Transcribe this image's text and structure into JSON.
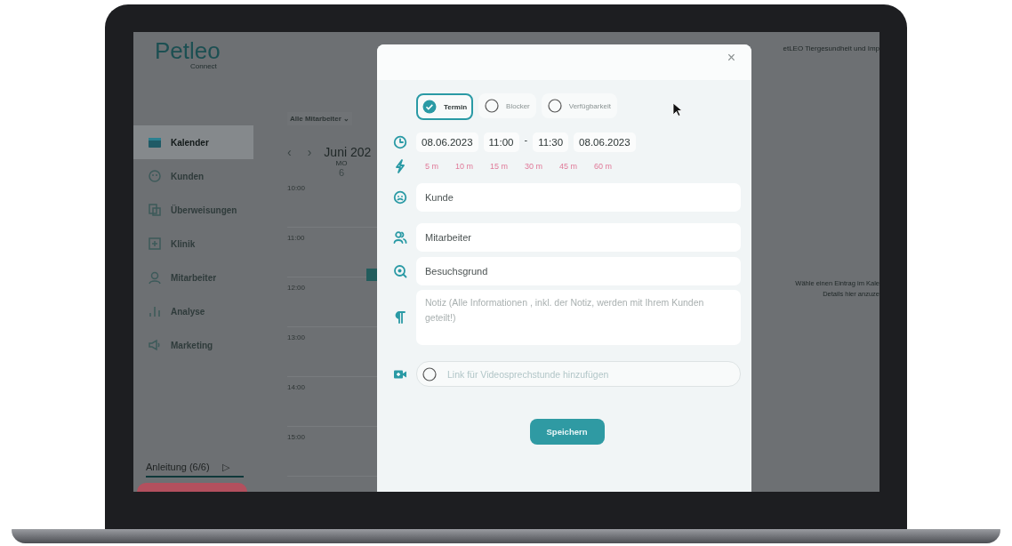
{
  "header": {
    "logo": "Petleo",
    "logo_sub": "Connect",
    "account": "etLEO Tiergesundheit und Imp"
  },
  "sidebar": {
    "items": [
      {
        "label": "Kalender",
        "selected": true
      },
      {
        "label": "Kunden",
        "selected": false
      },
      {
        "label": "Überweisungen",
        "selected": false
      },
      {
        "label": "Klinik",
        "selected": false
      },
      {
        "label": "Mitarbeiter",
        "selected": false
      },
      {
        "label": "Analyse",
        "selected": false
      },
      {
        "label": "Marketing",
        "selected": false
      }
    ],
    "guide": "Anleitung (6/6)",
    "guide_arrow": "▷"
  },
  "calendar": {
    "staff_filter": "Alle Mitarbeiter",
    "filter_caret": "⌄",
    "previous": "‹",
    "next": "›",
    "month": "Juni 202",
    "day_name": "MO",
    "day_number": "6",
    "times": [
      "10:00",
      "11:00",
      "12:00",
      "13:00",
      "14:00",
      "15:00"
    ]
  },
  "detail_hint": [
    "Wähle einen Eintrag im Kale",
    "Details hier anzuze"
  ],
  "modal": {
    "close": "×",
    "types": [
      {
        "label": "Termin",
        "selected": true
      },
      {
        "label": "Blocker",
        "selected": false
      },
      {
        "label": "Verfügbarkeit",
        "selected": false
      }
    ],
    "start_date": "08.06.2023",
    "start_time": "11:00",
    "separator": "-",
    "end_time": "11:30",
    "end_date": "08.06.2023",
    "durations": [
      "5 m",
      "10 m",
      "15 m",
      "30 m",
      "45 m",
      "60 m"
    ],
    "fields": [
      {
        "placeholder": "Kunde"
      },
      {
        "placeholder": "Mitarbeiter"
      },
      {
        "placeholder": "Besuchsgrund"
      }
    ],
    "note": {
      "placeholder": "Notiz (Alle Informationen , inkl. der Notiz, werden mit Ihrem Kunden geteilt!)"
    },
    "video": {
      "placeholder": "Link für Videosprechstunde hinzufügen",
      "checked": false
    },
    "save": "Speichern"
  }
}
